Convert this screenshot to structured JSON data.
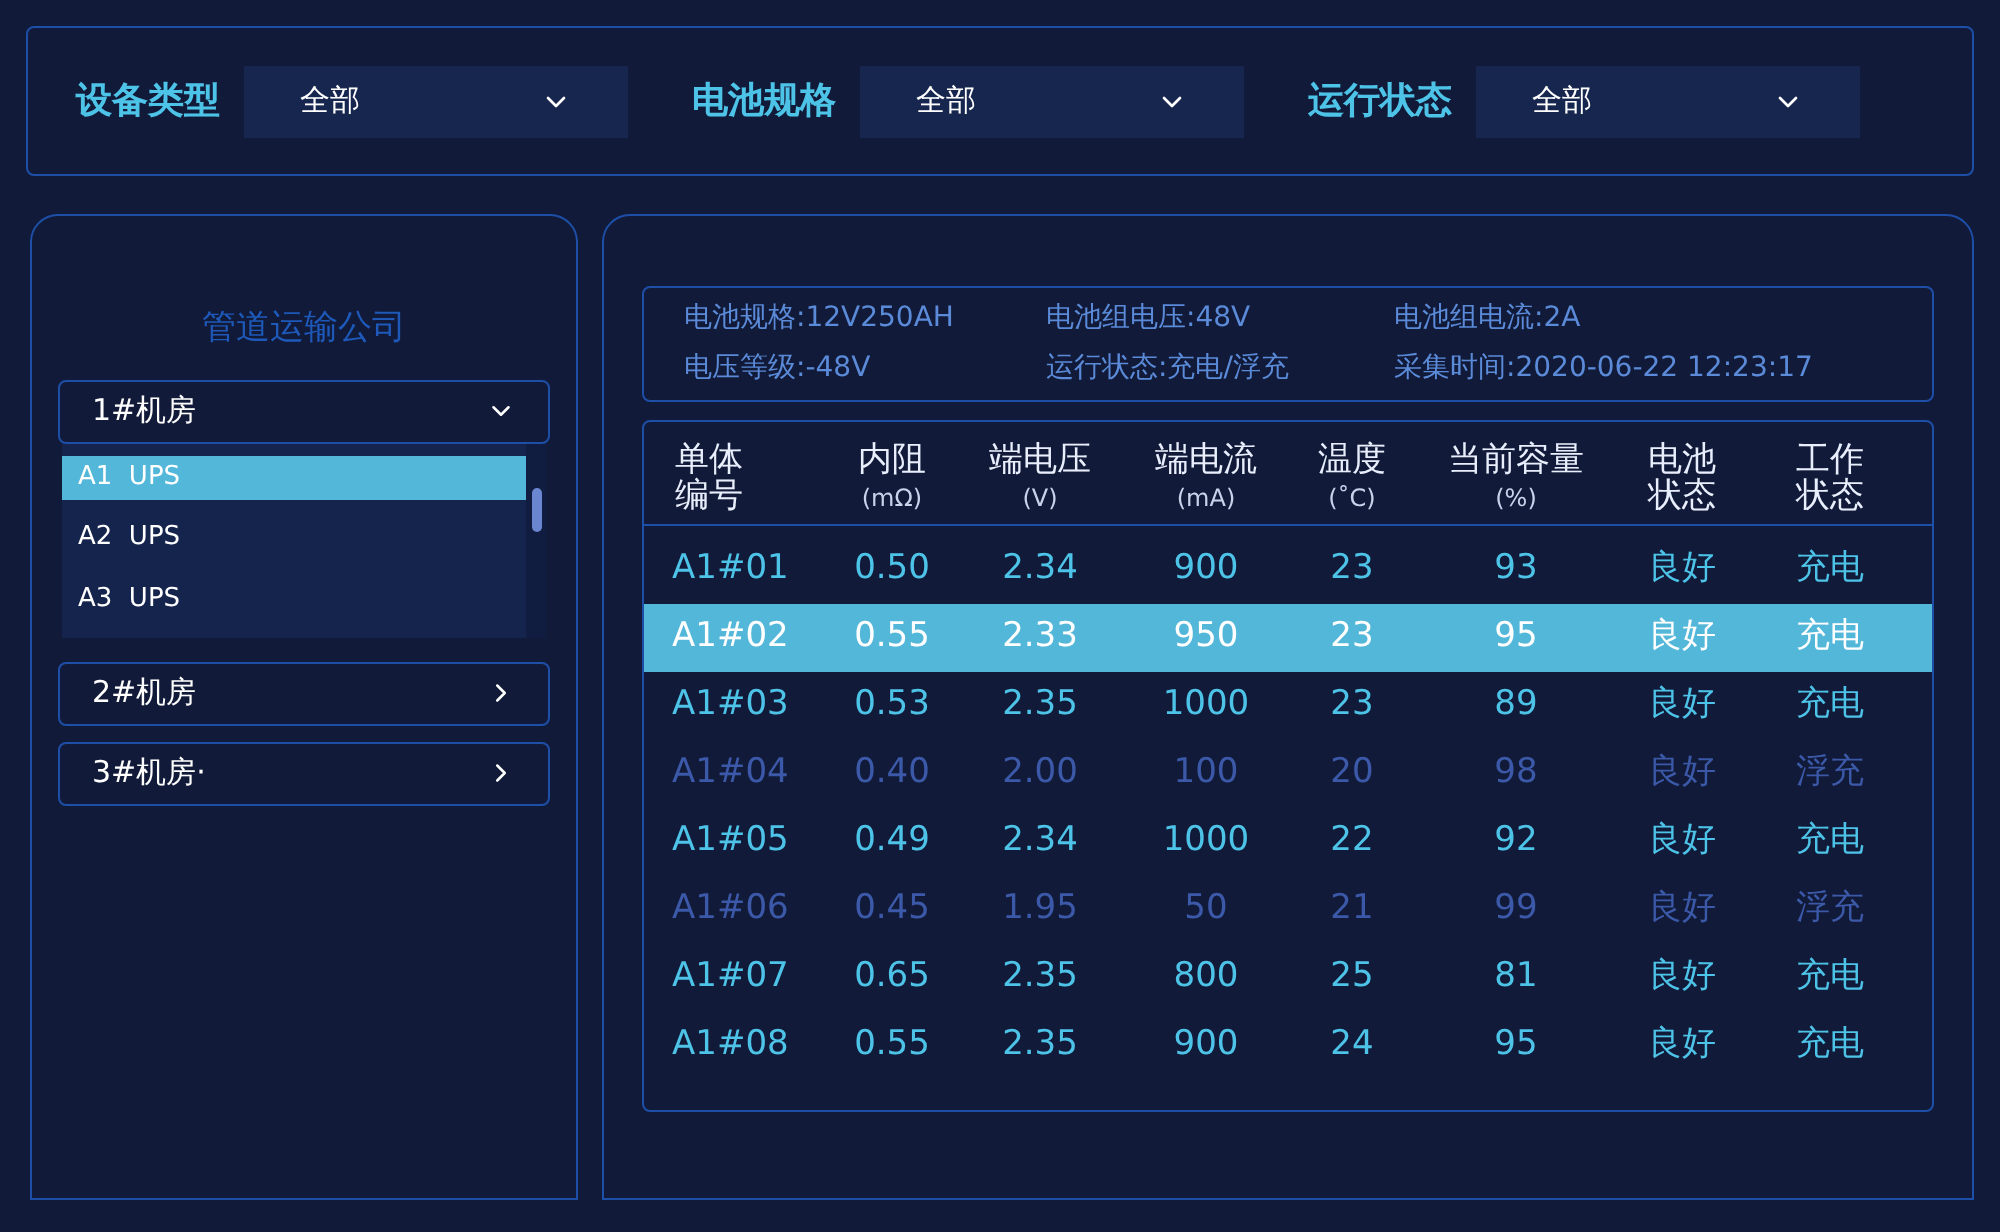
{
  "filters": [
    {
      "label": "设备类型",
      "value": "全部"
    },
    {
      "label": "电池规格",
      "value": "全部"
    },
    {
      "label": "运行状态",
      "value": "全部"
    }
  ],
  "sidebar": {
    "title": "管道运输公司",
    "groups": [
      {
        "label": "1#机房",
        "expanded": true,
        "items": [
          {
            "label": "A1  UPS",
            "selected": true
          },
          {
            "label": "A2  UPS",
            "selected": false
          },
          {
            "label": "A3  UPS",
            "selected": false
          }
        ]
      },
      {
        "label": "2#机房",
        "expanded": false
      },
      {
        "label": "3#机房·",
        "expanded": false
      }
    ]
  },
  "info": [
    "电池规格:12V250AH",
    "电池组电压:48V",
    "电池组电流:2A",
    "电压等级:-48V",
    "运行状态:充电/浮充",
    "采集时间:2020-06-22  12:23:17"
  ],
  "table": {
    "columns": [
      {
        "label": "单体编号"
      },
      {
        "label": "内阻",
        "unit": "(mΩ)"
      },
      {
        "label": "端电压",
        "unit": "(V)"
      },
      {
        "label": "端电流",
        "unit": "(mA)"
      },
      {
        "label": "温度",
        "unit": "(˚C)"
      },
      {
        "label": "当前容量",
        "unit": "(%)"
      },
      {
        "label": "电池状态"
      },
      {
        "label": "工作状态"
      }
    ],
    "rows": [
      {
        "cells": [
          "A1#01",
          "0.50",
          "2.34",
          "900",
          "23",
          "93",
          "良好",
          "充电"
        ],
        "selected": false,
        "dimmed": false
      },
      {
        "cells": [
          "A1#02",
          "0.55",
          "2.33",
          "950",
          "23",
          "95",
          "良好",
          "充电"
        ],
        "selected": true,
        "dimmed": false
      },
      {
        "cells": [
          "A1#03",
          "0.53",
          "2.35",
          "1000",
          "23",
          "89",
          "良好",
          "充电"
        ],
        "selected": false,
        "dimmed": false
      },
      {
        "cells": [
          "A1#04",
          "0.40",
          "2.00",
          "100",
          "20",
          "98",
          "良好",
          "浮充"
        ],
        "selected": false,
        "dimmed": true
      },
      {
        "cells": [
          "A1#05",
          "0.49",
          "2.34",
          "1000",
          "22",
          "92",
          "良好",
          "充电"
        ],
        "selected": false,
        "dimmed": false
      },
      {
        "cells": [
          "A1#06",
          "0.45",
          "1.95",
          "50",
          "21",
          "99",
          "良好",
          "浮充"
        ],
        "selected": false,
        "dimmed": true
      },
      {
        "cells": [
          "A1#07",
          "0.65",
          "2.35",
          "800",
          "25",
          "81",
          "良好",
          "充电"
        ],
        "selected": false,
        "dimmed": false
      },
      {
        "cells": [
          "A1#08",
          "0.55",
          "2.35",
          "900",
          "24",
          "95",
          "良好",
          "充电"
        ],
        "selected": false,
        "dimmed": false
      }
    ]
  }
}
